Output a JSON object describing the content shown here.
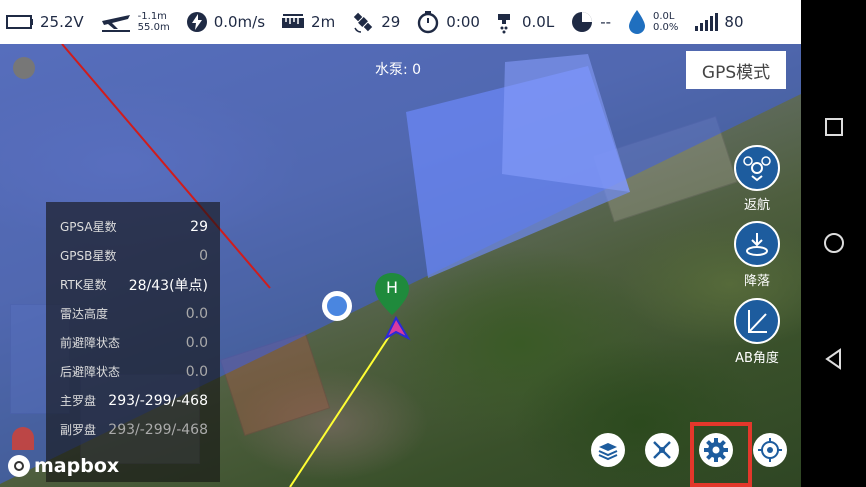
{
  "status_bar": {
    "voltage": "25.2V",
    "altitude_top": "-1.1m",
    "altitude_bottom": "55.0m",
    "speed": "0.0m/s",
    "distance": "2m",
    "satellites": "29",
    "flight_time": "0:00",
    "flow": "0.0L",
    "usage": "--",
    "tank_top": "0.0L",
    "tank_bottom": "0.0%",
    "signal": "80",
    "icons": [
      "battery-icon",
      "drone-altitude-icon",
      "speed-icon",
      "distance-icon",
      "satellite-icon",
      "timer-icon",
      "sprayer-icon",
      "pie-chart-icon",
      "water-drop-icon",
      "signal-bars-icon"
    ]
  },
  "map": {
    "pump_label": "水泵: 0",
    "gps_mode_button": "GPS模式",
    "home_marker_label": "H",
    "attribution": "mapbox",
    "colors": {
      "coverage_blue": "#3c5fe6",
      "path_line": "#ffff33",
      "boundary_line": "#d01c1c",
      "button_blue": "#1d5c9e",
      "highlight_red": "#e3372b"
    }
  },
  "right_buttons": [
    {
      "id": "return",
      "label": "返航",
      "icon": "drone-return-icon"
    },
    {
      "id": "land",
      "label": "降落",
      "icon": "landing-icon"
    },
    {
      "id": "ab_angle",
      "label": "AB角度",
      "icon": "ab-angle-icon"
    }
  ],
  "info_panel": {
    "rows": [
      {
        "key": "GPSA星数",
        "value": "29",
        "dim": false
      },
      {
        "key": "GPSB星数",
        "value": "0",
        "dim": true
      },
      {
        "key": "RTK星数",
        "value": "28/43(单点)",
        "dim": false
      },
      {
        "key": "雷达高度",
        "value": "0.0",
        "dim": true
      },
      {
        "key": "前避障状态",
        "value": "0.0",
        "dim": true
      },
      {
        "key": "后避障状态",
        "value": "0.0",
        "dim": true
      },
      {
        "key": "主罗盘",
        "value": "293/-299/-468",
        "dim": false
      },
      {
        "key": "副罗盘",
        "value": "293/-299/-468",
        "dim": true
      }
    ]
  },
  "bottom_buttons": [
    {
      "id": "layers",
      "icon": "layers-icon"
    },
    {
      "id": "tools",
      "icon": "tools-icon"
    },
    {
      "id": "settings",
      "icon": "gear-icon"
    },
    {
      "id": "locate",
      "icon": "crosshair-icon"
    }
  ],
  "nav_bar": {
    "icons": [
      "recent-apps-icon",
      "home-icon",
      "back-icon"
    ]
  }
}
